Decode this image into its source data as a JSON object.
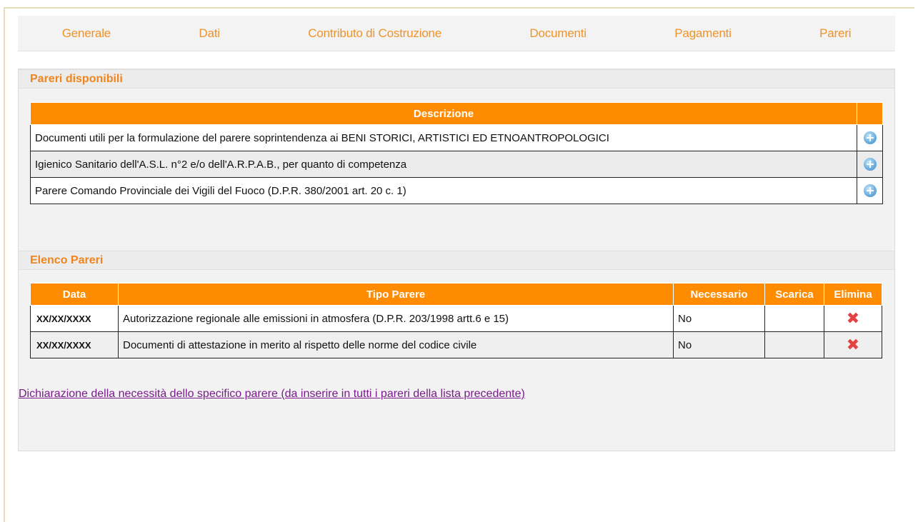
{
  "nav": {
    "items": [
      "Generale",
      "Dati",
      "Contributo di Costruzione",
      "Documenti",
      "Pagamenti",
      "Pareri"
    ]
  },
  "pareri_disponibili": {
    "title": "Pareri disponibili",
    "header": "Descrizione",
    "rows": [
      "Documenti utili per la formulazione del parere soprintendenza ai BENI STORICI, ARTISTICI ED ETNOANTROPOLOGICI",
      "Igienico Sanitario dell'A.S.L. n°2 e/o dell'A.R.P.A.B., per quanto di competenza",
      "Parere Comando Provinciale dei Vigili del Fuoco (D.P.R. 380/2001 art. 20 c. 1)"
    ],
    "row_icon": "add-circle-icon"
  },
  "elenco_pareri": {
    "title": "Elenco Pareri",
    "headers": {
      "data": "Data",
      "tipo": "Tipo Parere",
      "necessario": "Necessario",
      "scarica": "Scarica",
      "elimina": "Elimina"
    },
    "rows": [
      {
        "data": "XX/XX/XXXX",
        "tipo": "Autorizzazione regionale alle emissioni in atmosfera (D.P.R. 203/1998 artt.6 e 15)",
        "necessario": "No",
        "scarica": ""
      },
      {
        "data": "XX/XX/XXXX",
        "tipo": "Documenti di attestazione in merito al rispetto delle norme del codice civile",
        "necessario": "No",
        "scarica": ""
      }
    ],
    "delete_icon": "✖"
  },
  "declaration_link": "Dichiarazione della necessità dello specifico parere (da inserire in tutti i pareri della lista precedente)",
  "colors": {
    "accent": "#ff8c00",
    "nav_text": "#f0922a",
    "section_title": "#f0851c",
    "delete": "#e44242",
    "link": "#7a1b8c"
  }
}
